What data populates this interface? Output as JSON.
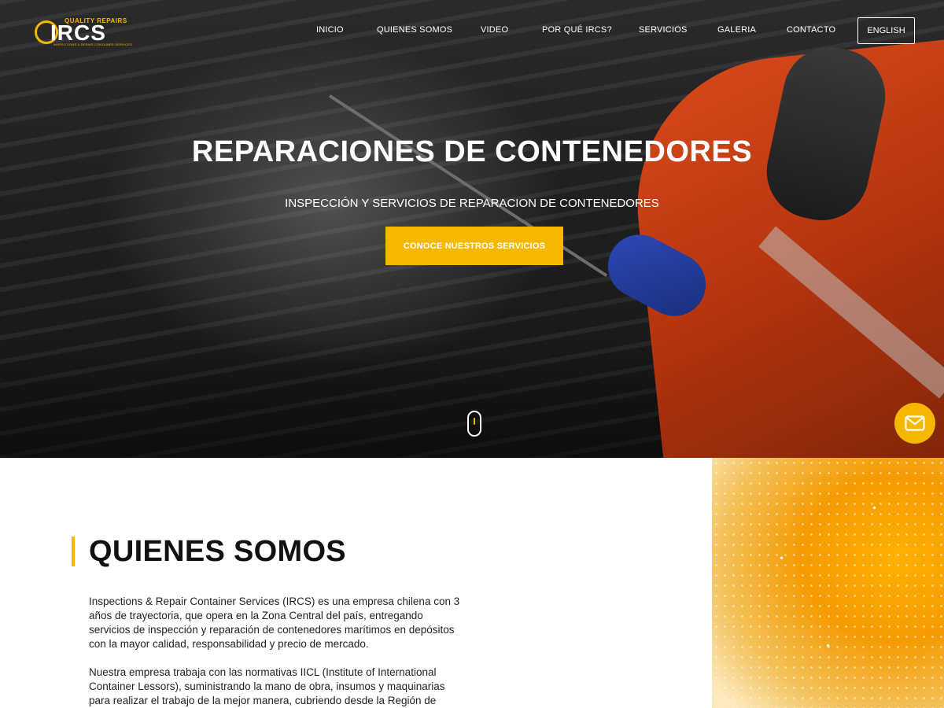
{
  "brand": {
    "logo_tagline": "QUALITY REPAIRS",
    "logo_name": "IRCS",
    "logo_subline": "INSPECTIONS & REPAIR CONTAINER SERVICES"
  },
  "nav": {
    "items": [
      {
        "label": "INICIO"
      },
      {
        "label": "QUIENES SOMOS"
      },
      {
        "label": "VIDEO"
      },
      {
        "label": "POR QUÉ IRCS?"
      },
      {
        "label": "SERVICIOS"
      },
      {
        "label": "GALERIA"
      },
      {
        "label": "CONTACTO"
      }
    ],
    "language_button": "ENGLISH"
  },
  "hero": {
    "title": "REPARACIONES DE CONTENEDORES",
    "subtitle": "INSPECCIÓN Y SERVICIOS DE REPARACION DE CONTENEDORES",
    "cta_label": "CONOCE NUESTROS SERVICIOS",
    "scroll_icon": "mouse-scroll-icon"
  },
  "contact_fab": {
    "icon": "mail-icon"
  },
  "about": {
    "title": "QUIENES SOMOS",
    "paragraph_1": "Inspections & Repair Container Services (IRCS) es una empresa chilena con 3 años de trayectoria, que opera en la Zona Central del país, entregando servicios de inspección y reparación de contenedores marítimos en depósitos con la mayor calidad, responsabilidad y precio de mercado.",
    "paragraph_2": "Nuestra empresa trabaja con las normativas IICL (Institute of International Container Lessors), suministrando la mano de obra, insumos y maquinarias para realizar el trabajo de la mejor manera, cubriendo desde la Región de"
  },
  "colors": {
    "accent": "#f5b800",
    "text_dark": "#111111",
    "hero_overlay": "#1f1f1f"
  }
}
